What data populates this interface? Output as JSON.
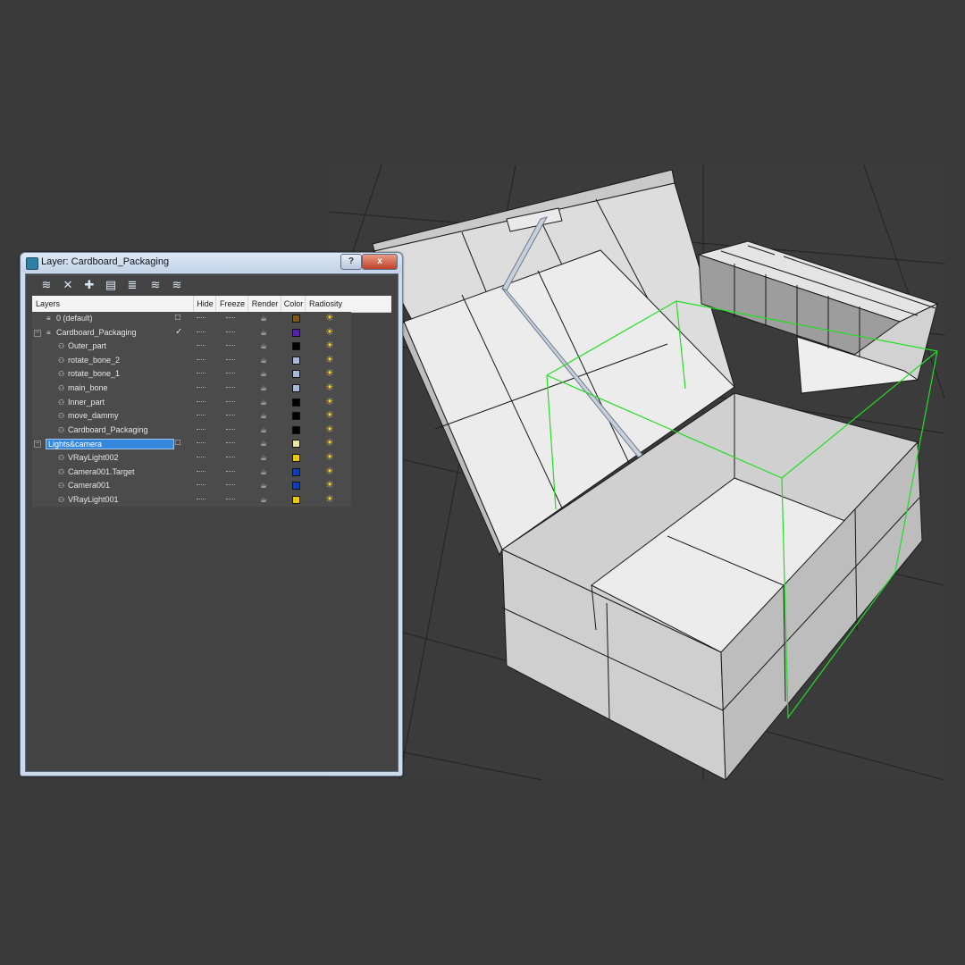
{
  "dialog": {
    "title": "Layer: Cardboard_Packaging",
    "help_label": "?",
    "close_label": "x"
  },
  "toolbar": {
    "icons": [
      "new-layer-icon",
      "delete-icon",
      "add-icon",
      "select-icon",
      "highlight-icon",
      "hide-all-icon",
      "freeze-all-icon"
    ]
  },
  "columns": {
    "layers": "Layers",
    "hide": "Hide",
    "freeze": "Freeze",
    "render": "Render",
    "color": "Color",
    "radiosity": "Radiosity"
  },
  "layers": [
    {
      "name": "0 (default)",
      "level": 0,
      "expander": "",
      "current_marker": "□",
      "color": "#7a5a14"
    },
    {
      "name": "Cardboard_Packaging",
      "level": 0,
      "expander": "−",
      "current_marker": "✓",
      "color": "#5522aa"
    },
    {
      "name": "Outer_part",
      "level": 1,
      "expander": "",
      "current_marker": "",
      "color": "#000000"
    },
    {
      "name": "rotate_bone_2",
      "level": 1,
      "expander": "",
      "current_marker": "",
      "color": "#a8b8d8"
    },
    {
      "name": "rotate_bone_1",
      "level": 1,
      "expander": "",
      "current_marker": "",
      "color": "#a8b8d8"
    },
    {
      "name": "main_bone",
      "level": 1,
      "expander": "",
      "current_marker": "",
      "color": "#a8b8d8"
    },
    {
      "name": "Inner_part",
      "level": 1,
      "expander": "",
      "current_marker": "",
      "color": "#000000"
    },
    {
      "name": "move_dammy",
      "level": 1,
      "expander": "",
      "current_marker": "",
      "color": "#000000"
    },
    {
      "name": "Cardboard_Packaging",
      "level": 1,
      "expander": "",
      "current_marker": "",
      "color": "#000000"
    },
    {
      "name": "Lights&camera",
      "level": 0,
      "expander": "−",
      "current_marker": "□",
      "color": "#e6e6a0",
      "selected": true
    },
    {
      "name": "VRayLight002",
      "level": 1,
      "expander": "",
      "current_marker": "",
      "color": "#e8c800"
    },
    {
      "name": "Camera001.Target",
      "level": 1,
      "expander": "",
      "current_marker": "",
      "color": "#1040b0"
    },
    {
      "name": "Camera001",
      "level": 1,
      "expander": "",
      "current_marker": "",
      "color": "#1040b0"
    },
    {
      "name": "VRayLight001",
      "level": 1,
      "expander": "",
      "current_marker": "",
      "color": "#e8c800"
    }
  ],
  "colors": {
    "selection": "#3388dd",
    "wire_green": "#22dd22",
    "mesh_face": "#e9e9e9",
    "mesh_shade": "#c8c8c8"
  }
}
